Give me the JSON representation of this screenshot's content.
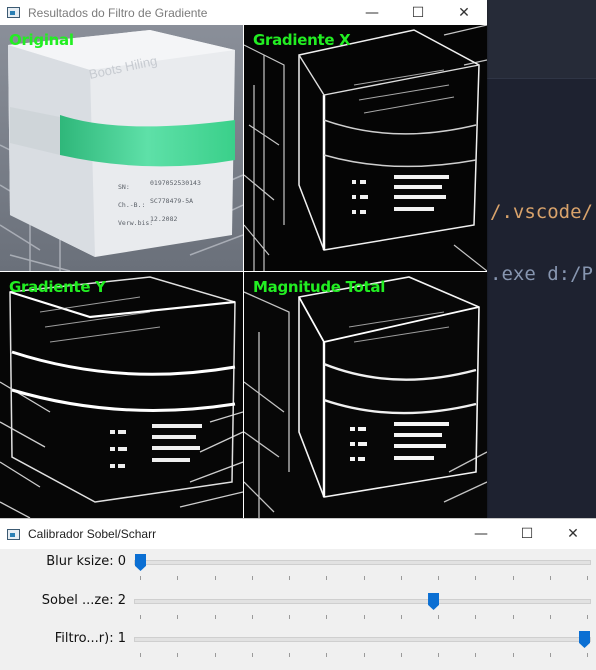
{
  "editor": {
    "line1": "/.vscode/",
    "line2": ".exe d:/P"
  },
  "gradient_window": {
    "title": "Resultados do Filtro de Gradiente",
    "controls": {
      "minimize": "—",
      "maximize": "☐",
      "close": "✕"
    },
    "panels": {
      "original": "Original",
      "grad_x": "Gradiente X",
      "grad_y": "Gradiente Y",
      "magnitude": "Magnitude Total"
    },
    "box_text": {
      "brand": "Boots Hiling",
      "sn_label": "SN:",
      "sn_value": "0197052530143",
      "ch_label": "Ch.-B.:",
      "ch_value": "SC778479-5A",
      "exp_label": "Verw.bis:",
      "exp_value": "12.2082"
    }
  },
  "calibrator_window": {
    "title": "Calibrador Sobel/Scharr",
    "controls": {
      "minimize": "—",
      "maximize": "☐",
      "close": "✕"
    },
    "sliders": [
      {
        "label": "Blur ksize: 0",
        "value_fraction": 0.0
      },
      {
        "label": "Sobel ...ze: 2",
        "value_fraction": 0.66
      },
      {
        "label": "Filtro...r): 1",
        "value_fraction": 1.0
      }
    ]
  },
  "colors": {
    "label_green": "#22ee22",
    "slider_thumb": "#0b6fd3",
    "box_accent": "#3ad08a"
  }
}
